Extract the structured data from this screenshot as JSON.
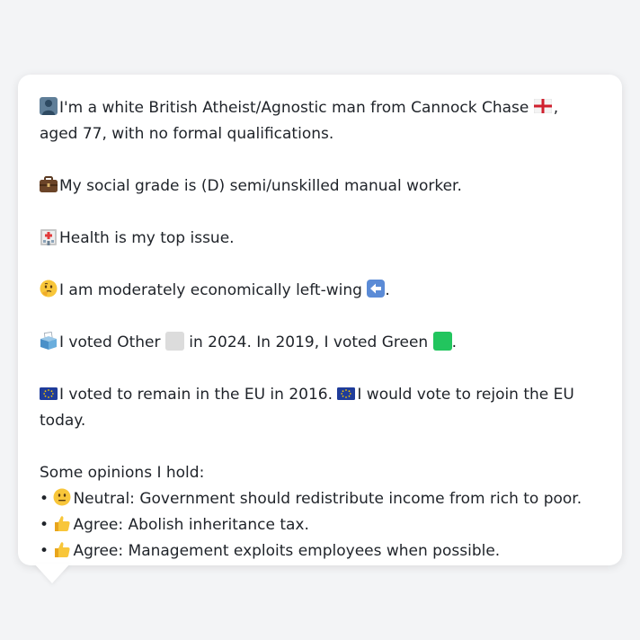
{
  "profile": {
    "line1_pre": "I'm a white British Atheist/Agnostic man from Cannock Chase",
    "line1_post": ", aged 77, with no formal qualifications.",
    "social_grade": "My social grade is (D) semi/unskilled manual worker.",
    "top_issue": "Health is my top issue.",
    "economic_pre": "I am moderately economically left-wing",
    "economic_post": ".",
    "vote_a": "I voted Other",
    "vote_b": "in 2024. In 2019, I voted Green",
    "vote_c": ".",
    "eu_a": "I voted to remain in the EU in 2016.",
    "eu_b": "I would vote to rejoin the EU today.",
    "opinions_heading": "Some opinions I hold:",
    "opinions": [
      {
        "bullet": "•",
        "text": "Neutral: Government should redistribute income from rich to poor."
      },
      {
        "bullet": "•",
        "text": "Agree: Abolish inheritance tax."
      },
      {
        "bullet": "•",
        "text": "Agree: Management exploits employees when possible."
      }
    ]
  },
  "icons": {
    "person": "person-silhouette-icon",
    "england_flag": "england-flag-icon",
    "briefcase": "briefcase-icon",
    "hospital": "hospital-icon",
    "thinking": "thinking-face-icon",
    "left_arrow": "left-arrow-icon",
    "ballot": "ballot-box-icon",
    "eu_flag": "eu-flag-icon",
    "neutral_face": "neutral-face-icon",
    "thumbs_up": "thumbs-up-icon"
  },
  "colors": {
    "background": "#f3f4f6",
    "bubble": "#ffffff",
    "text": "#1f2329",
    "other_party": "#dcdcdc",
    "green_party": "#22c55e",
    "arrow_blue": "#5b8bd6",
    "eu_blue": "#1f3c9a",
    "eu_gold": "#f5c400",
    "england_red": "#d0202e"
  }
}
